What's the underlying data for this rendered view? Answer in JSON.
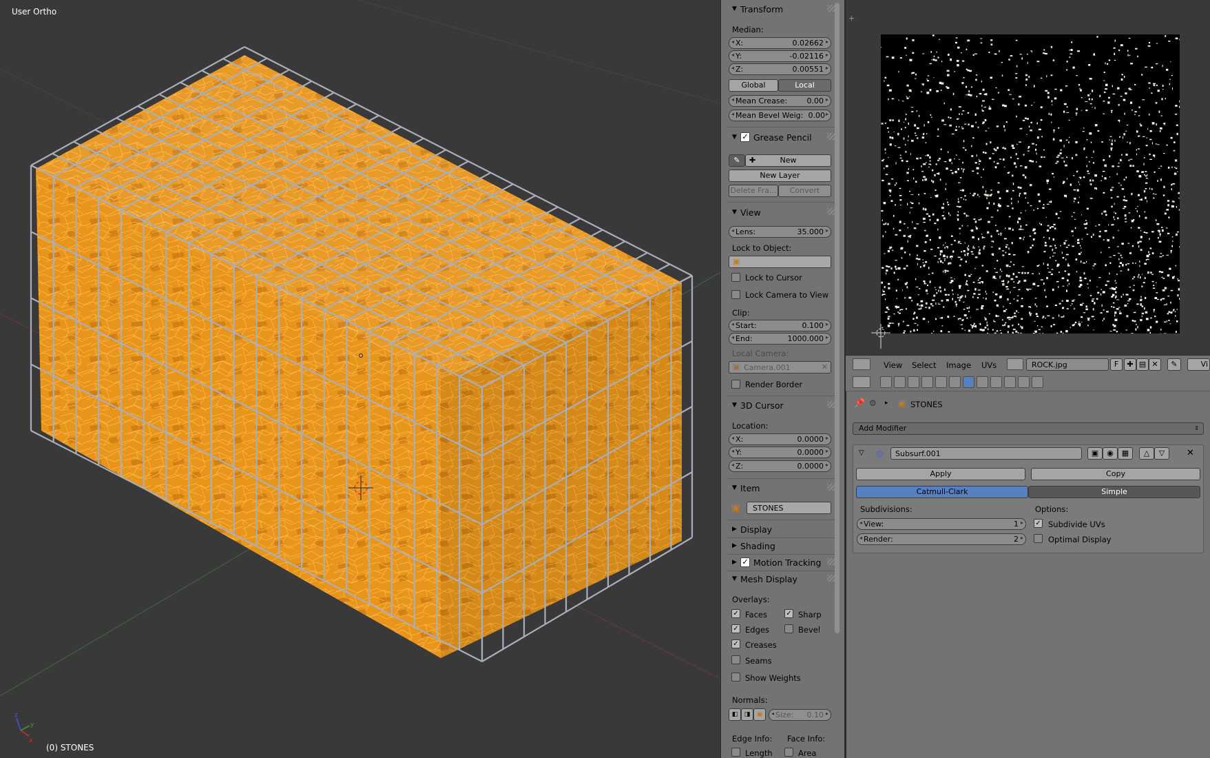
{
  "viewport": {
    "title": "User Ortho",
    "status": "(0) STONES"
  },
  "transform": {
    "header": "Transform",
    "median_label": "Median:",
    "x_label": "X:",
    "x_value": "0.02662",
    "y_label": "Y:",
    "y_value": "-0.02116",
    "z_label": "Z:",
    "z_value": "0.00551",
    "global": "Global",
    "local": "Local",
    "mean_crease_label": "Mean Crease:",
    "mean_crease_value": "0.00",
    "mean_bevel_label": "Mean Bevel Weig:",
    "mean_bevel_value": "0.00"
  },
  "grease_pencil": {
    "header": "Grease Pencil",
    "new": "New",
    "new_layer": "New Layer",
    "delete_frame": "Delete Fra...",
    "convert": "Convert"
  },
  "view": {
    "header": "View",
    "lens_label": "Lens:",
    "lens_value": "35.000",
    "lock_to_object": "Lock to Object:",
    "lock_to_cursor": "Lock to Cursor",
    "lock_camera": "Lock Camera to View",
    "clip": "Clip:",
    "start_label": "Start:",
    "start_value": "0.100",
    "end_label": "End:",
    "end_value": "1000.000",
    "local_camera": "Local Camera:",
    "camera_name": "Camera.001",
    "render_border": "Render Border"
  },
  "cursor3d": {
    "header": "3D Cursor",
    "location": "Location:",
    "x_label": "X:",
    "x_value": "0.0000",
    "y_label": "Y:",
    "y_value": "0.0000",
    "z_label": "Z:",
    "z_value": "0.0000"
  },
  "item": {
    "header": "Item",
    "name": "STONES"
  },
  "collapsed": {
    "display": "Display",
    "shading": "Shading",
    "motion_tracking": "Motion Tracking"
  },
  "mesh_display": {
    "header": "Mesh Display",
    "overlays": "Overlays:",
    "faces": "Faces",
    "sharp": "Sharp",
    "edges": "Edges",
    "bevel": "Bevel",
    "creases": "Creases",
    "seams": "Seams",
    "show_weights": "Show Weights",
    "normals": "Normals:",
    "size_label": "Size:",
    "size_value": "0.10",
    "edge_info": "Edge Info:",
    "face_info": "Face Info:",
    "length": "Length",
    "area": "Area"
  },
  "image_editor": {
    "menu_view": "View",
    "menu_select": "Select",
    "menu_image": "Image",
    "menu_uvs": "UVs",
    "image_name": "ROCK.jpg",
    "fake_user": "F",
    "right_tab": "Vi"
  },
  "properties": {
    "object_name": "STONES",
    "add_modifier": "Add Modifier",
    "modifier_name": "Subsurf.001",
    "apply": "Apply",
    "copy": "Copy",
    "catmull": "Catmull-Clark",
    "simple": "Simple",
    "subdivisions": "Subdivisions:",
    "options": "Options:",
    "view_label": "View:",
    "view_value": "1",
    "render_label": "Render:",
    "render_value": "2",
    "subdivide_uvs": "Subdivide UVs",
    "optimal_display": "Optimal Display"
  },
  "colors": {
    "stone": "#e8951c",
    "wire": "#a9aebb",
    "accent": "#5680c2"
  }
}
